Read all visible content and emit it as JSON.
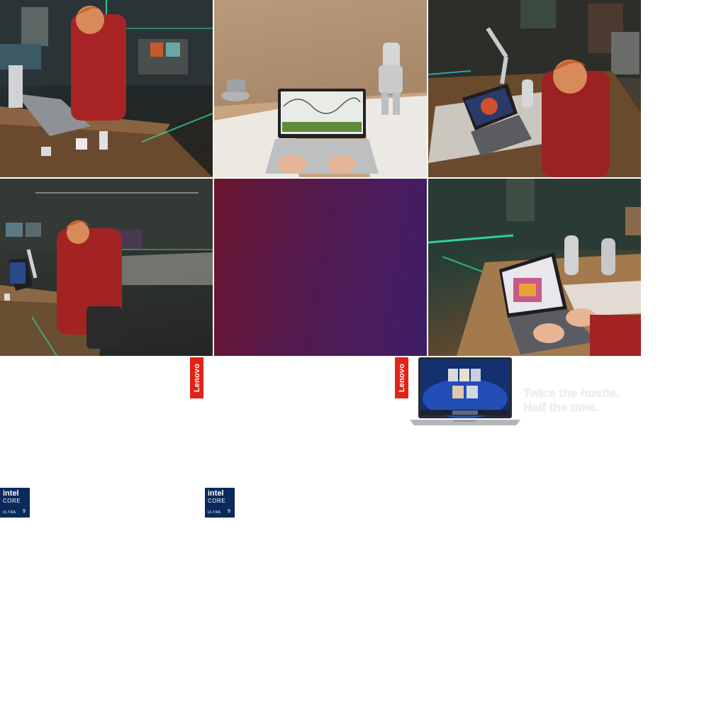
{
  "photos": [
    {
      "id": "photo-lab-standing",
      "accent": "#2ee6a0"
    },
    {
      "id": "photo-desk-sketch",
      "accent": "#c9a07a"
    },
    {
      "id": "photo-workshop-seated",
      "accent": "#26c6c8"
    },
    {
      "id": "photo-lab-wide",
      "accent": "#2ee6a0"
    },
    {
      "id": "photo-gradient-panel",
      "accent": "#5a1a52"
    },
    {
      "id": "photo-laptop-closeup",
      "accent": "#2ee6a0"
    }
  ],
  "brand": {
    "lenovo_label": "Lenovo",
    "lenovo_color": "#e2231a",
    "intel_line1": "intel",
    "intel_line2": "CORE",
    "intel_line3": "ULTRA",
    "intel_line4": "9",
    "intel_color": "#0b2a5c"
  },
  "promo": {
    "headline_line1": "Twice the hustle.",
    "headline_line2": "Half the time."
  }
}
